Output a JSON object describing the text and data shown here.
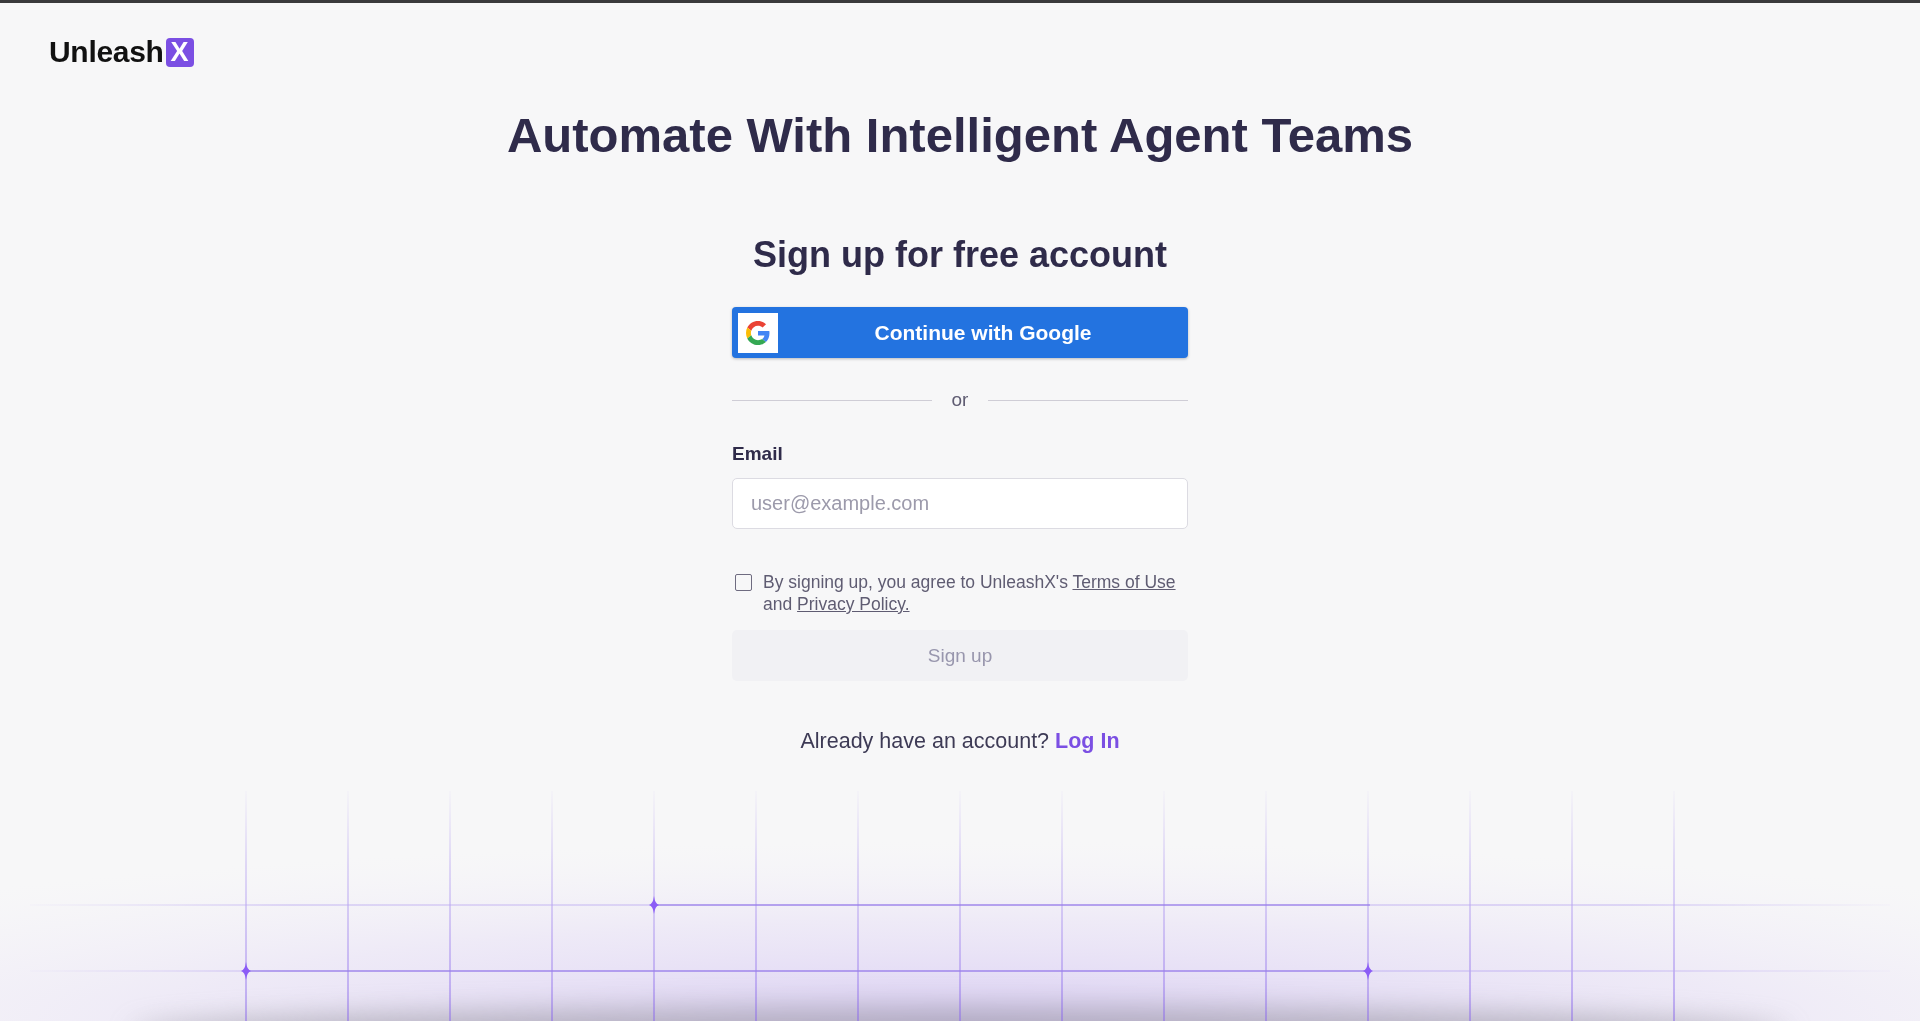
{
  "logo": {
    "text": "Unleash",
    "mark": "X"
  },
  "headline": "Automate With Intelligent Agent Teams",
  "signup_form": {
    "title": "Sign up for free account",
    "google_button": {
      "label": "Continue with Google"
    },
    "divider": "or",
    "email": {
      "label": "Email",
      "placeholder": "user@example.com"
    },
    "consent": {
      "checked": false,
      "text": "By signing up, you agree to UnleashX's",
      "terms_link": "Terms of Use",
      "conjunction": "and",
      "privacy_link": "Privacy Policy."
    },
    "submit_button": {
      "label": "Sign up",
      "disabled": true
    },
    "login_prompt": {
      "text": "Already have an account?",
      "link": "Log In"
    }
  }
}
